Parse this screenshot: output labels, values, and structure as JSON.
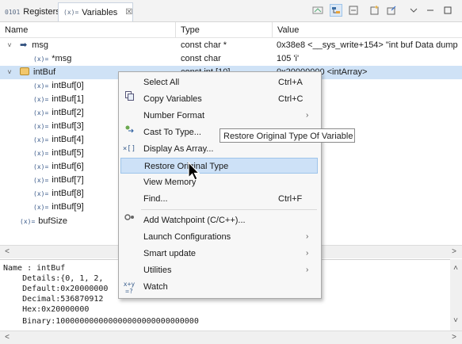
{
  "tabs": [
    {
      "icon": "0101",
      "label": "Registers"
    },
    {
      "icon": "(x)=",
      "label": "Variables",
      "close": "☒"
    }
  ],
  "toolbar_icons": [
    "show-type-names-icon",
    "show-logical-structure-icon",
    "collapse-all-icon",
    "new-view-icon",
    "pin-icon",
    "view-menu-icon",
    "minimize-icon",
    "maximize-icon"
  ],
  "columns": {
    "name": "Name",
    "type": "Type",
    "value": "Value"
  },
  "rows": [
    {
      "twisty": "˅",
      "icon": "arrow",
      "name": "msg",
      "type": "const char *",
      "value": "0x38e8 <__sys_write+154> \"int buf Data dump"
    },
    {
      "twisty": "",
      "icon": "(x)=",
      "name": "*msg",
      "type": "const char",
      "value": "105 'i'"
    },
    {
      "twisty": "˅",
      "icon": "array",
      "name": "intBuf",
      "type": "const int [10]",
      "value": "0x20000000 <intArray>"
    },
    {
      "twisty": "",
      "icon": "(x)=",
      "name": "intBuf[0]",
      "type": "",
      "value": ""
    },
    {
      "twisty": "",
      "icon": "(x)=",
      "name": "intBuf[1]",
      "type": "",
      "value": ""
    },
    {
      "twisty": "",
      "icon": "(x)=",
      "name": "intBuf[2]",
      "type": "",
      "value": ""
    },
    {
      "twisty": "",
      "icon": "(x)=",
      "name": "intBuf[3]",
      "type": "",
      "value": ""
    },
    {
      "twisty": "",
      "icon": "(x)=",
      "name": "intBuf[4]",
      "type": "",
      "value": ""
    },
    {
      "twisty": "",
      "icon": "(x)=",
      "name": "intBuf[5]",
      "type": "",
      "value": ""
    },
    {
      "twisty": "",
      "icon": "(x)=",
      "name": "intBuf[6]",
      "type": "",
      "value": ""
    },
    {
      "twisty": "",
      "icon": "(x)=",
      "name": "intBuf[7]",
      "type": "",
      "value": ""
    },
    {
      "twisty": "",
      "icon": "(x)=",
      "name": "intBuf[8]",
      "type": "",
      "value": ""
    },
    {
      "twisty": "",
      "icon": "(x)=",
      "name": "intBuf[9]",
      "type": "",
      "value": ""
    },
    {
      "twisty": "",
      "icon": "(x)=",
      "name": "bufSize",
      "type": "",
      "value": ""
    }
  ],
  "details": [
    "Name : intBuf",
    "    Details:{0, 1, 2,",
    "    Default:0x20000000",
    "    Decimal:536870912",
    "    Hex:0x20000000",
    "    Binary:100000000000000000000000000000"
  ],
  "menu": [
    {
      "label": "Select All",
      "shortcut": "Ctrl+A",
      "icon": "",
      "sub": false
    },
    {
      "label": "Copy Variables",
      "shortcut": "Ctrl+C",
      "icon": "copy-icon",
      "sub": false
    },
    {
      "label": "Number Format",
      "shortcut": "",
      "icon": "",
      "sub": true
    },
    {
      "label": "Cast To Type...",
      "shortcut": "",
      "icon": "cast-icon",
      "sub": false
    },
    {
      "label": "Display As Array...",
      "shortcut": "",
      "icon": "array-display-icon",
      "sub": false
    },
    {
      "label": "Restore Original Type",
      "shortcut": "",
      "icon": "",
      "sub": false,
      "highlighted": true
    },
    {
      "label": "View Memory",
      "shortcut": "",
      "icon": "",
      "sub": false
    },
    {
      "label": "Find...",
      "shortcut": "Ctrl+F",
      "icon": "",
      "sub": false
    },
    {
      "label": "Add Watchpoint (C/C++)...",
      "shortcut": "",
      "icon": "watchpoint-icon",
      "sub": false
    },
    {
      "label": "Launch Configurations",
      "shortcut": "",
      "icon": "",
      "sub": true
    },
    {
      "label": "Smart update",
      "shortcut": "",
      "icon": "",
      "sub": true
    },
    {
      "label": "Utilities",
      "shortcut": "",
      "icon": "",
      "sub": true
    },
    {
      "label": "Watch",
      "shortcut": "",
      "icon": "watch-expression-icon",
      "sub": false
    }
  ],
  "tooltip": "Restore Original Type Of Variable",
  "accent": "#cfe2f6"
}
